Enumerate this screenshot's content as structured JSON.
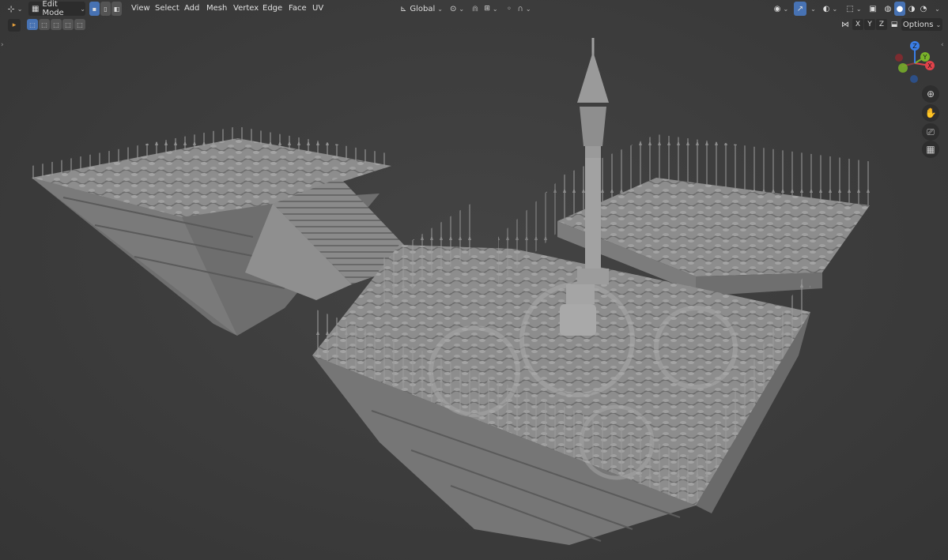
{
  "header": {
    "editor_type_icon": "editor-type-icon",
    "mode_label": "Edit Mode",
    "menus": [
      "View",
      "Select",
      "Add",
      "Mesh",
      "Vertex",
      "Edge",
      "Face",
      "UV"
    ],
    "transform_orientation": "Global",
    "options_label": "Options"
  },
  "axis_toggles": [
    "X",
    "Y",
    "Z"
  ],
  "gizmo": {
    "x": "X",
    "y": "Y",
    "z": "Z"
  },
  "colors": {
    "accent": "#4772b3",
    "x_axis": "#e0424a",
    "y_axis": "#7ab32a",
    "z_axis": "#3a7ee6",
    "viewport_bg": "#3a3a3a"
  }
}
